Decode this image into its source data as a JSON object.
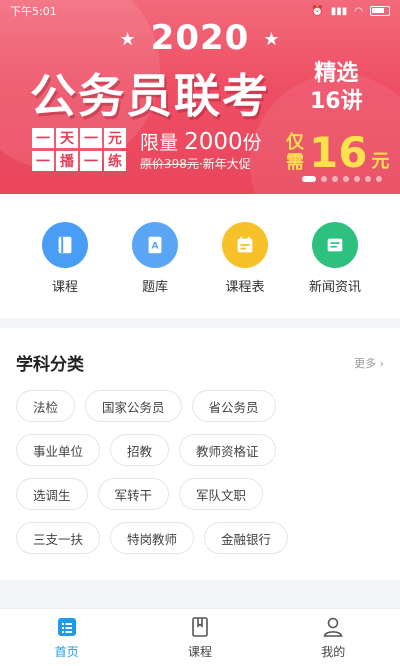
{
  "status_bar": {
    "time": "下午5:01"
  },
  "banner": {
    "year": "2020",
    "headline": "公务员联考",
    "side_line1": "精选",
    "side_line2": "16讲",
    "tags": [
      "一",
      "天",
      "一",
      "元",
      "一",
      "播",
      "一",
      "练"
    ],
    "limit_prefix": "限量",
    "limit_value": "2000",
    "limit_suffix": "份",
    "original_price": "原价398元",
    "promo": "·新年大促",
    "price_label_1": "仅",
    "price_label_2": "需",
    "price": "16",
    "price_unit": "元",
    "slide_count": 7,
    "active_slide": 0
  },
  "quick_nav": [
    {
      "label": "课程",
      "icon": "book-icon",
      "color": "#4a9df5"
    },
    {
      "label": "题库",
      "icon": "question-bank-icon",
      "color": "#5aa6f4"
    },
    {
      "label": "课程表",
      "icon": "schedule-icon",
      "color": "#f7c12a"
    },
    {
      "label": "新闻资讯",
      "icon": "news-icon",
      "color": "#2ec07f"
    }
  ],
  "categories": {
    "title": "学科分类",
    "more": "更多 ›",
    "rows": [
      [
        "法检",
        "国家公务员",
        "省公务员"
      ],
      [
        "事业单位",
        "招教",
        "教师资格证"
      ],
      [
        "选调生",
        "军转干",
        "军队文职"
      ],
      [
        "三支一扶",
        "特岗教师",
        "金融银行"
      ]
    ]
  },
  "tab_bar": [
    {
      "label": "首页",
      "icon": "home-list-icon",
      "active": true
    },
    {
      "label": "课程",
      "icon": "course-book-icon",
      "active": false
    },
    {
      "label": "我的",
      "icon": "user-icon",
      "active": false
    }
  ],
  "colors": {
    "accent": "#1e9be8",
    "banner": "#ee4e64",
    "price": "#ffe14d"
  }
}
